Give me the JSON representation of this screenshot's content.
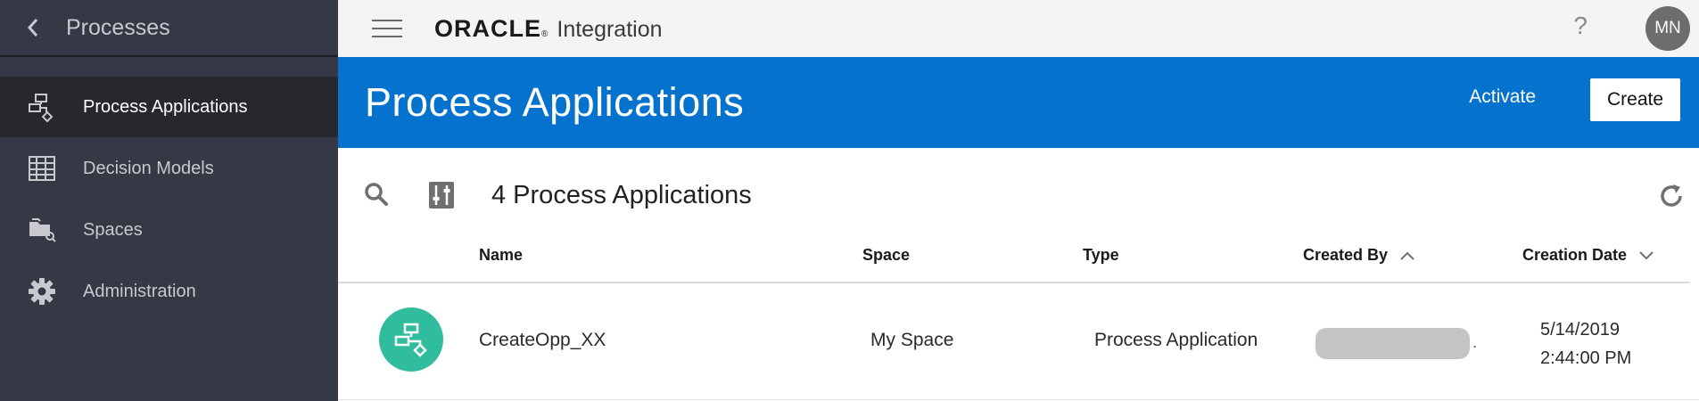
{
  "sidebar": {
    "title": "Processes",
    "items": [
      {
        "label": "Process Applications",
        "icon": "process-app-icon",
        "active": true
      },
      {
        "label": "Decision Models",
        "icon": "table-grid-icon",
        "active": false
      },
      {
        "label": "Spaces",
        "icon": "spaces-folder-icon",
        "active": false
      },
      {
        "label": "Administration",
        "icon": "gear-icon",
        "active": false
      }
    ]
  },
  "topbar": {
    "brand": "ORACLE",
    "brand_tm": "®",
    "product": "Integration",
    "help": "?",
    "avatar_initials": "MN"
  },
  "header": {
    "title": "Process Applications",
    "activate_label": "Activate",
    "create_label": "Create",
    "background": "#0572ce"
  },
  "toolbar": {
    "count_label": "4 Process Applications"
  },
  "table": {
    "columns": [
      "Name",
      "Space",
      "Type",
      "Created By",
      "Creation Date"
    ],
    "sort": {
      "created_by": "ascending",
      "creation_date": "descending"
    },
    "rows": [
      {
        "name": "CreateOpp_XX",
        "space": "My Space",
        "type": "Process Application",
        "created_by_suffix": ".",
        "date": "5/14/2019",
        "time": "2:44:00 PM",
        "icon_color": "#30bd9d"
      }
    ]
  }
}
